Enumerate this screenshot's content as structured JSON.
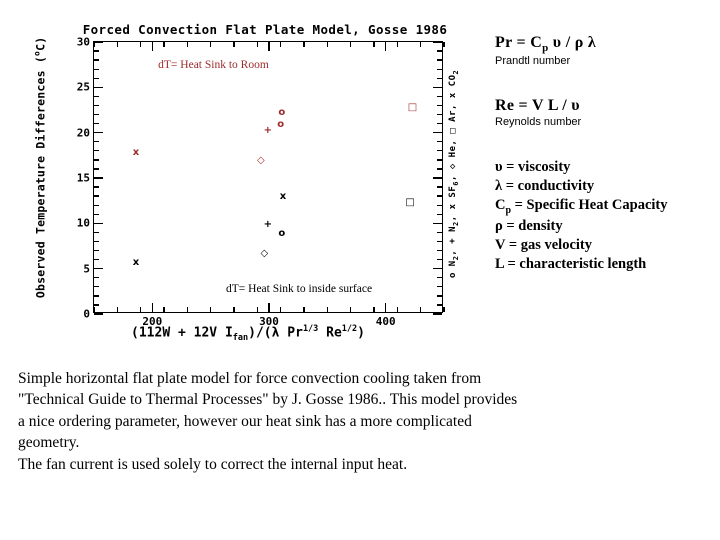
{
  "figure": {
    "title": "Forced Convection Flat Plate Model, Gosse 1986",
    "ylabel_main": "Observed Temperature Differences (",
    "ylabel_deg": "o",
    "ylabel_tail": "C)",
    "xlabel_p1": "(112W + 12V I",
    "xlabel_sub1": "fan",
    "xlabel_p2": ")/(λ Pr",
    "xlabel_sup1": "1/3",
    "xlabel_p3": " Re",
    "xlabel_sup2": "1/2",
    "xlabel_p4": ")",
    "right_legend": "o N",
    "right_legend_sub1": "2",
    "right_legend_b": ", + N",
    "right_legend_sub2": "2",
    "right_legend_c": ", x SF",
    "right_legend_sub3": "6",
    "right_legend_d": ", ◇ He, □ Ar, x CO",
    "right_legend_sub4": "2",
    "annotation_red": "dT= Heat Sink to Room",
    "annotation_black": "dT= Heat Sink to inside surface",
    "marker_red_color": "#9c2b2b",
    "marker_black_color": "#000000"
  },
  "chart_data": {
    "type": "scatter",
    "title": "Forced Convection Flat Plate Model, Gosse 1986",
    "xlabel": "(112W + 12V I_fan)/(λ Pr^(1/3) Re^(1/2))",
    "ylabel": "Observed Temperature Differences (°C)",
    "xlim": [
      150,
      450
    ],
    "ylim": [
      0,
      30
    ],
    "xticks": [
      200,
      300,
      400
    ],
    "xtick_labels": [
      "200",
      "300",
      "400"
    ],
    "yticks": [
      0,
      5,
      10,
      15,
      20,
      25,
      30
    ],
    "ytick_labels": [
      "0",
      "5",
      "10",
      "15",
      "20",
      "25",
      "30"
    ],
    "grid": false,
    "legend": "right-side rotated: o N2, + N2, x SF6, ◇ He, □ Ar, x CO2",
    "annotations": [
      {
        "text": "dT= Heat Sink to Room",
        "color": "#9c2b2b",
        "x": 205,
        "y": 27.3
      },
      {
        "text": "dT= Heat Sink to inside surface",
        "color": "#000000",
        "x": 330,
        "y": 2.6
      }
    ],
    "series": [
      {
        "name": "dT = Heat Sink to Room",
        "color": "#9c2b2b",
        "points": [
          {
            "marker": "x",
            "x": 186,
            "y": 17.8
          },
          {
            "marker": "+",
            "x": 299,
            "y": 20.2
          },
          {
            "marker": "o",
            "x": 311,
            "y": 22.2
          },
          {
            "marker": "o",
            "x": 310,
            "y": 20.8
          },
          {
            "marker": "◇",
            "x": 293,
            "y": 16.9
          },
          {
            "marker": "□",
            "x": 423,
            "y": 22.7
          }
        ]
      },
      {
        "name": "dT = Heat Sink to inside surface",
        "color": "#000000",
        "points": [
          {
            "marker": "x",
            "x": 186,
            "y": 5.6
          },
          {
            "marker": "x",
            "x": 312,
            "y": 12.9
          },
          {
            "marker": "+",
            "x": 299,
            "y": 9.8
          },
          {
            "marker": "o",
            "x": 311,
            "y": 8.8
          },
          {
            "marker": "◇",
            "x": 296,
            "y": 6.6
          },
          {
            "marker": "□",
            "x": 421,
            "y": 12.2
          }
        ]
      }
    ]
  },
  "definitions": {
    "prandtl_eq_a": "Pr = C",
    "prandtl_eq_sub": "p",
    "prandtl_eq_b": " υ / ρ λ",
    "prandtl_caption": "Prandtl number",
    "reynolds_eq": "Re = V L / υ",
    "reynolds_caption": "Reynolds number",
    "list": [
      {
        "a": "υ =  viscosity",
        "sub": "",
        "b": ""
      },
      {
        "a": "λ = conductivity",
        "sub": "",
        "b": ""
      },
      {
        "a": "C",
        "sub": "p",
        "b": " = Specific Heat Capacity"
      },
      {
        "a": "ρ = density",
        "sub": "",
        "b": ""
      },
      {
        "a": "V = gas velocity",
        "sub": "",
        "b": ""
      },
      {
        "a": "L = characteristic length",
        "sub": "",
        "b": ""
      }
    ]
  },
  "paragraph": {
    "line1": "Simple horizontal flat plate model for force convection cooling taken from",
    "line2": "\"Technical Guide to Thermal Processes\" by J. Gosse 1986..  This model provides",
    "line3": "a nice ordering parameter, however our heat sink has a more complicated",
    "line4": "geometry.",
    "line5": " The fan current is used solely to correct the internal input heat."
  }
}
